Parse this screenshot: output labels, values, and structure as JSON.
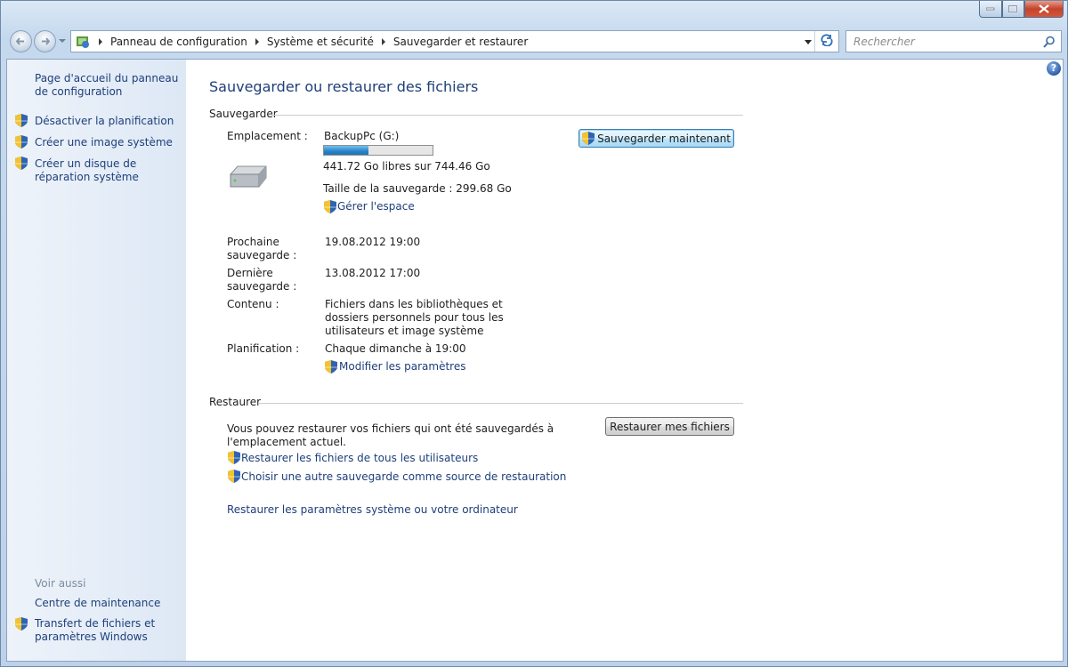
{
  "window": {
    "title": ""
  },
  "nav": {
    "breadcrumbs": [
      "Panneau de configuration",
      "Système et sécurité",
      "Sauvegarder et restaurer"
    ],
    "search_placeholder": "Rechercher"
  },
  "sidebar": {
    "home_link": "Page d'accueil du panneau de configuration",
    "tasks": [
      {
        "label": "Désactiver la planification",
        "icon": "shield-icon"
      },
      {
        "label": "Créer une image système",
        "icon": "shield-icon"
      },
      {
        "label": "Créer un disque de réparation système",
        "icon": "shield-icon"
      }
    ],
    "see_also_title": "Voir aussi",
    "see_also": [
      {
        "label": "Centre de maintenance",
        "icon": ""
      },
      {
        "label": "Transfert de fichiers et paramètres Windows",
        "icon": "shield-icon"
      }
    ]
  },
  "main": {
    "title": "Sauvegarder ou restaurer des fichiers",
    "backup": {
      "section_label": "Sauvegarder",
      "location_label": "Emplacement :",
      "location_value": "BackupPc (G:)",
      "free_space": "441.72 Go libres sur 744.46 Go",
      "used_fraction": 0.41,
      "backup_size": "Taille de la sauvegarde : 299.68 Go",
      "manage_space": "Gérer l'espace",
      "next_label": "Prochaine sauvegarde :",
      "next_value": "19.08.2012 19:00",
      "last_label": "Dernière sauvegarde :",
      "last_value": "13.08.2012 17:00",
      "contents_label": "Contenu :",
      "contents_value": "Fichiers dans les bibliothèques et dossiers personnels pour tous les utilisateurs et image système",
      "schedule_label": "Planification :",
      "schedule_value": "Chaque dimanche à 19:00",
      "change_settings": "Modifier les paramètres",
      "backup_now_button": "Sauvegarder maintenant"
    },
    "restore": {
      "section_label": "Restaurer",
      "description": "Vous pouvez restaurer vos fichiers qui ont été sauvegardés à l'emplacement actuel.",
      "restore_button": "Restaurer mes fichiers",
      "restore_all_users": "Restaurer les fichiers de tous les utilisateurs",
      "choose_other": "Choisir une autre sauvegarde comme source de restauration",
      "recover_system": "Restaurer les paramètres système ou votre ordinateur"
    }
  },
  "colors": {
    "link": "#1e3f7a",
    "accent": "#2b82c9",
    "sidebar_bg": "#e4edf7"
  }
}
